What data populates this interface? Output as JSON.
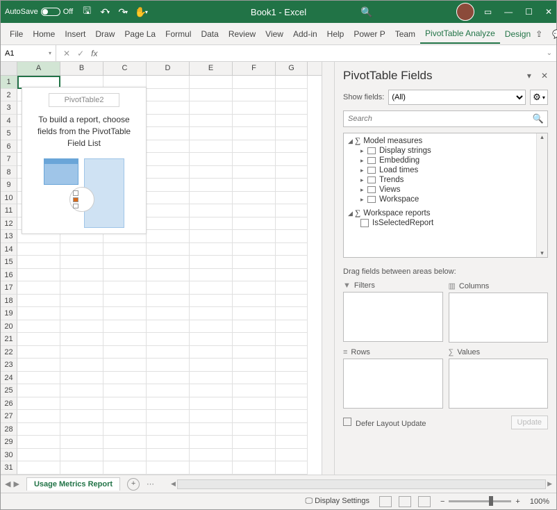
{
  "titlebar": {
    "autosave_label": "AutoSave",
    "autosave_state": "Off",
    "document": "Book1 - Excel"
  },
  "ribbon": {
    "tabs": [
      "File",
      "Home",
      "Insert",
      "Draw",
      "Page La",
      "Formul",
      "Data",
      "Review",
      "View",
      "Add-in",
      "Help",
      "Power P",
      "Team",
      "PivotTable Analyze",
      "Design"
    ],
    "active_index": 13
  },
  "formula": {
    "cell_ref": "A1",
    "fx_label": "fx",
    "value": ""
  },
  "grid": {
    "columns": [
      "A",
      "B",
      "C",
      "D",
      "E",
      "F",
      "G"
    ],
    "rows": 31
  },
  "pivot_placeholder": {
    "name": "PivotTable2",
    "text": "To build a report, choose fields from the PivotTable Field List"
  },
  "fields_pane": {
    "title": "PivotTable Fields",
    "show_fields_label": "Show fields:",
    "show_fields_value": "(All)",
    "search_placeholder": "Search",
    "groups": [
      {
        "name": "Model measures",
        "children": [
          "Display strings",
          "Embedding",
          "Load times",
          "Trends",
          "Views",
          "Workspace"
        ]
      },
      {
        "name": "Workspace reports",
        "leaf": "IsSelectedReport"
      }
    ],
    "drag_text": "Drag fields between areas below:",
    "areas": {
      "filters": "Filters",
      "columns": "Columns",
      "rows": "Rows",
      "values": "Values"
    },
    "defer_label": "Defer Layout Update",
    "update_label": "Update"
  },
  "sheet_tabs": {
    "active": "Usage Metrics Report"
  },
  "status": {
    "display_settings": "Display Settings",
    "zoom": "100%"
  }
}
